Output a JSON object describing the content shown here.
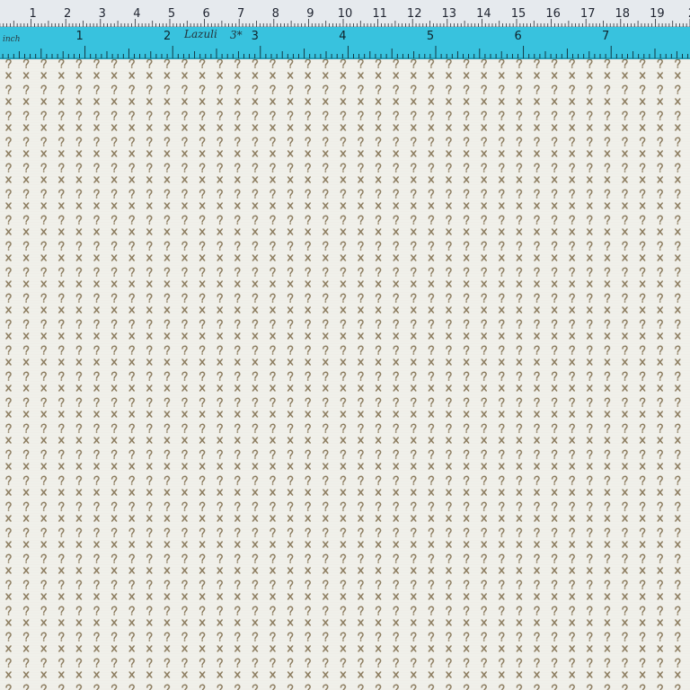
{
  "image": {
    "subject": "fabric swatch",
    "palette": {
      "fabric_background": "#efeee8",
      "motif": "#8a7a5c",
      "cm_ruler": "#e6eaee",
      "inch_ruler": "#38c2de",
      "ink": "#1f2430"
    },
    "cm_ruler": {
      "numbers": [
        "1",
        "2",
        "3",
        "4",
        "5",
        "6",
        "7",
        "8",
        "9",
        "10",
        "11",
        "12",
        "13",
        "14",
        "15",
        "16",
        "17",
        "18",
        "19",
        "2"
      ]
    },
    "inch_ruler": {
      "unit_label": "inch",
      "numbers": [
        "1",
        "2",
        "3",
        "4",
        "5",
        "6",
        "7"
      ],
      "handwritten_label": "Lazuli",
      "handwritten_code": "3*"
    }
  }
}
